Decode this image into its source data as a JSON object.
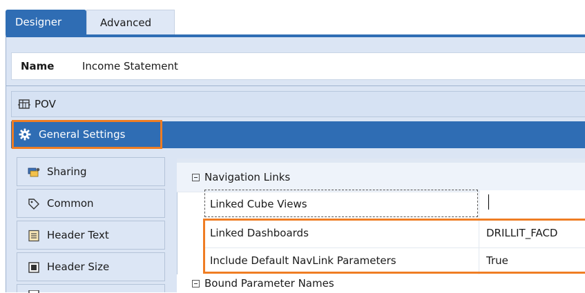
{
  "tabs": [
    {
      "label": "Designer",
      "active": true
    },
    {
      "label": "Advanced",
      "active": false
    }
  ],
  "name_field": {
    "label": "Name",
    "value": "Income Statement"
  },
  "sections": {
    "pov": {
      "label": "POV",
      "icon": "pov-grid-icon"
    },
    "general_settings": {
      "label": "General Settings",
      "icon": "gear-icon",
      "highlighted": true
    }
  },
  "nav_items": [
    {
      "label": "Sharing",
      "icon": "sharing-icon"
    },
    {
      "label": "Common",
      "icon": "tag-icon"
    },
    {
      "label": "Header Text",
      "icon": "header-text-icon"
    },
    {
      "label": "Header Size",
      "icon": "header-size-icon"
    }
  ],
  "properties": {
    "group_navigation": "Navigation Links",
    "rows": [
      {
        "name": "Linked Cube Views",
        "value": ""
      },
      {
        "name": "Linked Dashboards",
        "value": "DRILLIT_FACD"
      },
      {
        "name": "Include Default NavLink Parameters",
        "value": "True"
      }
    ],
    "group_bound": "Bound Parameter Names"
  },
  "colors": {
    "accent_blue": "#2f6db4",
    "highlight_orange": "#ef7d23",
    "panel_bg": "#dbe5f4"
  }
}
